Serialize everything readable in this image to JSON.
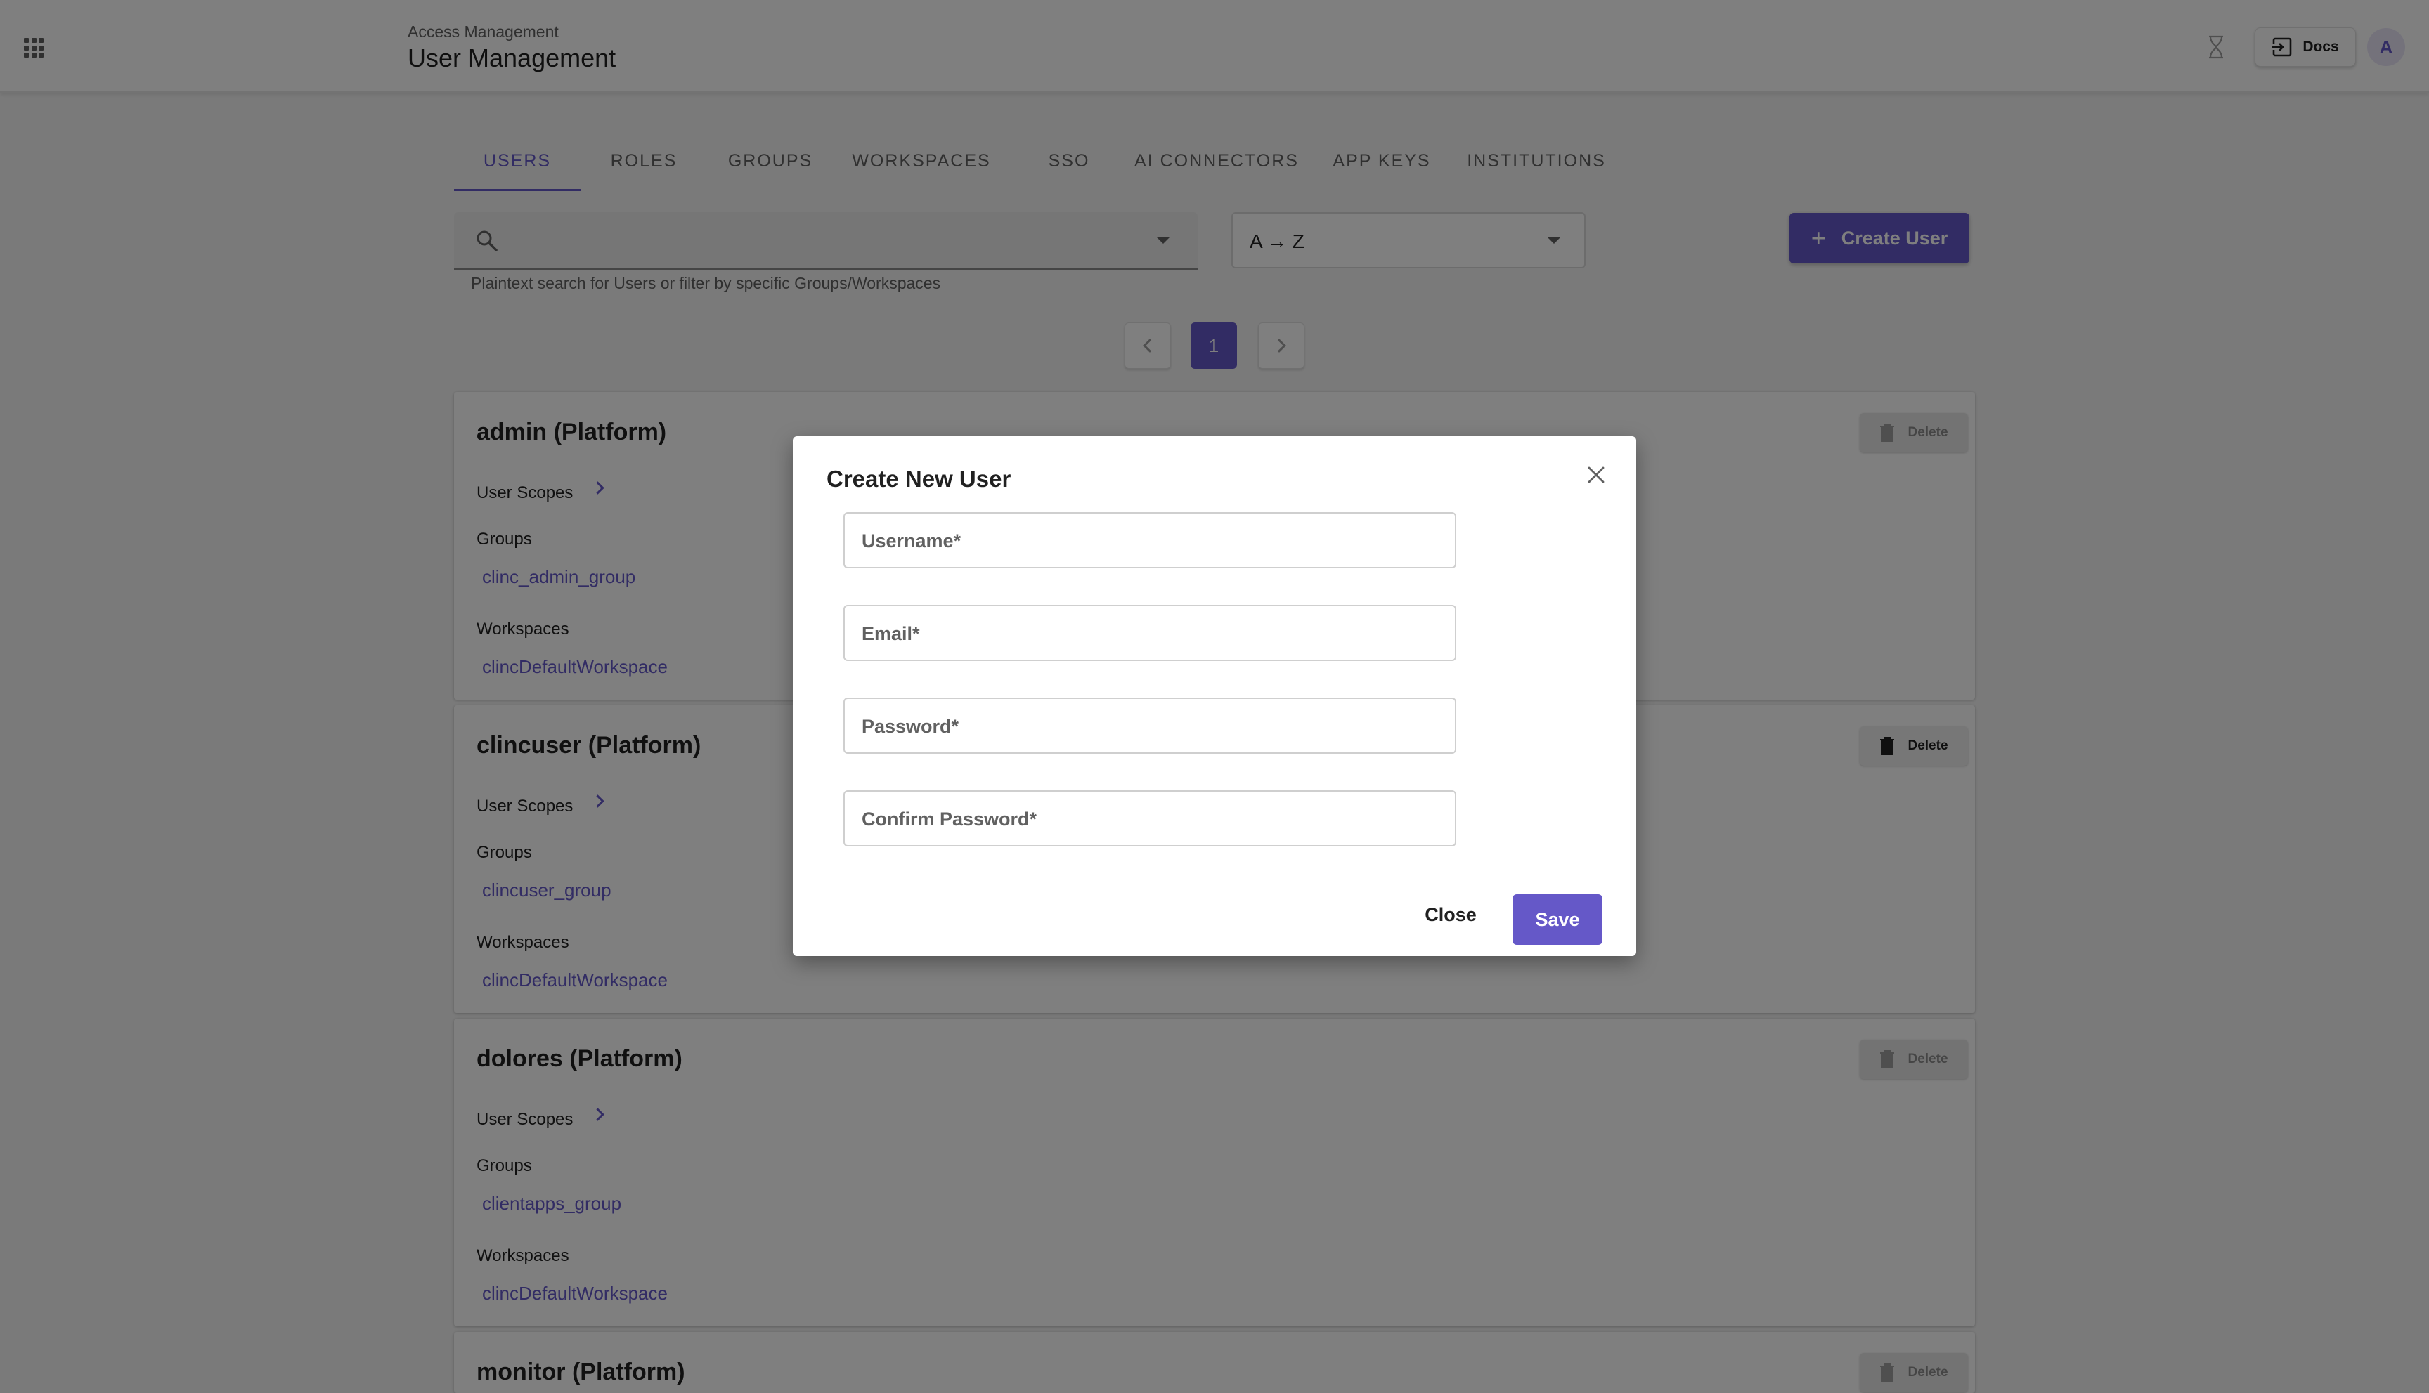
{
  "header": {
    "breadcrumb": "Access Management",
    "title": "User Management",
    "docs_label": "Docs",
    "avatar_initial": "A"
  },
  "tabs": [
    {
      "label": "USERS",
      "active": true
    },
    {
      "label": "ROLES"
    },
    {
      "label": "GROUPS"
    },
    {
      "label": "WORKSPACES"
    },
    {
      "label": "SSO"
    },
    {
      "label": "AI CONNECTORS"
    },
    {
      "label": "APP KEYS"
    },
    {
      "label": "INSTITUTIONS"
    }
  ],
  "search": {
    "value": "",
    "helper": "Plaintext search for Users or filter by specific Groups/Workspaces"
  },
  "sort": {
    "value": "A → Z"
  },
  "create_user_label": "Create User",
  "pagination": {
    "current": "1"
  },
  "users": [
    {
      "title": "admin (Platform)",
      "group": "clinc_admin_group",
      "workspace": "clincDefaultWorkspace",
      "delete_enabled": false
    },
    {
      "title": "clincuser (Platform)",
      "group": "clincuser_group",
      "workspace": "clincDefaultWorkspace",
      "delete_enabled": true
    },
    {
      "title": "dolores (Platform)",
      "group": "clientapps_group",
      "workspace": "clincDefaultWorkspace",
      "delete_enabled": false
    },
    {
      "title": "monitor (Platform)",
      "delete_enabled": false
    }
  ],
  "card_labels": {
    "user_scopes": "User Scopes",
    "groups": "Groups",
    "workspaces": "Workspaces",
    "delete": "Delete"
  },
  "modal": {
    "title": "Create New User",
    "fields": [
      {
        "placeholder": "Username*"
      },
      {
        "placeholder": "Email*"
      },
      {
        "placeholder": "Password*"
      },
      {
        "placeholder": "Confirm Password*"
      }
    ],
    "close_label": "Close",
    "save_label": "Save"
  },
  "colors": {
    "accent": "#6558c8",
    "link": "#6558c8",
    "overlay": "rgba(0,0,0,0.5)"
  }
}
